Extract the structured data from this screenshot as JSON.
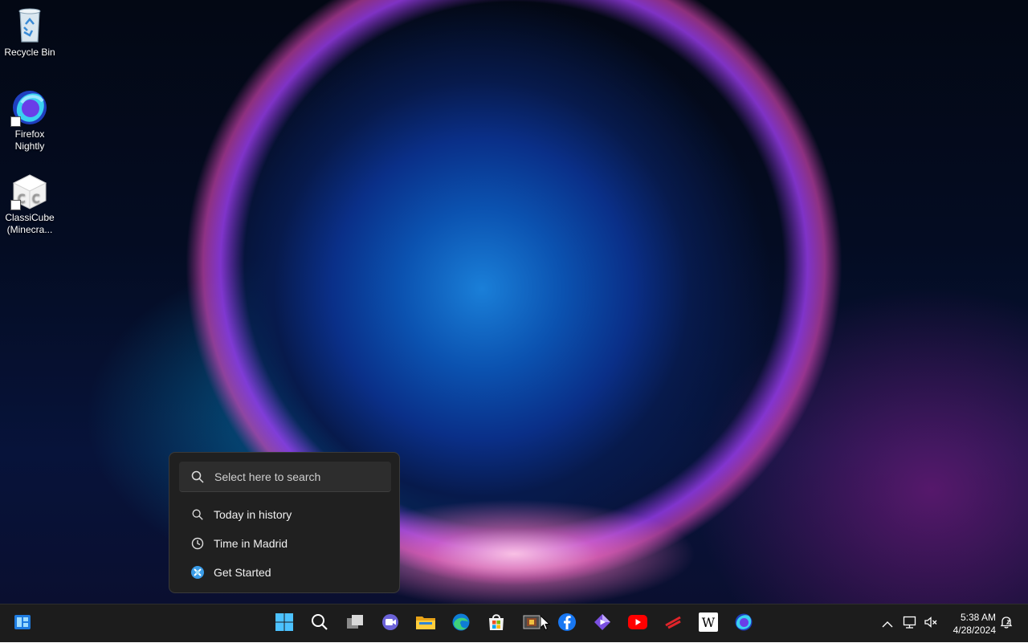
{
  "desktop": {
    "icons": [
      {
        "label": "Recycle Bin",
        "icon": "recycle-bin-icon"
      },
      {
        "label": "Firefox\nNightly",
        "icon": "firefox-nightly-icon"
      },
      {
        "label": "ClassiCube\n(Minecra...",
        "icon": "classicube-icon"
      }
    ]
  },
  "search_flyout": {
    "placeholder": "Select here to search",
    "items": [
      {
        "label": "Today in history",
        "icon": "search-icon"
      },
      {
        "label": "Time in Madrid",
        "icon": "clock-icon"
      },
      {
        "label": "Get Started",
        "icon": "get-started-icon"
      }
    ]
  },
  "taskbar": {
    "widgets": "widgets-icon",
    "apps": [
      "start-icon",
      "search-icon",
      "task-view-icon",
      "teams-chat-icon",
      "file-explorer-icon",
      "edge-icon",
      "microsoft-store-icon",
      "app-icon",
      "facebook-icon",
      "clipchamp-icon",
      "youtube-icon",
      "app-red-icon",
      "wikipedia-icon",
      "firefox-nightly-icon"
    ],
    "tray": [
      "chevron-up-icon",
      "network-icon",
      "volume-muted-icon",
      "notification-icon"
    ],
    "clock": {
      "time": "5:38 AM",
      "date": "4/28/2024"
    }
  },
  "colors": {
    "taskbar_bg": "#1c1c1c",
    "flyout_bg": "#202020",
    "windows_blue": "#4cc2ff"
  }
}
